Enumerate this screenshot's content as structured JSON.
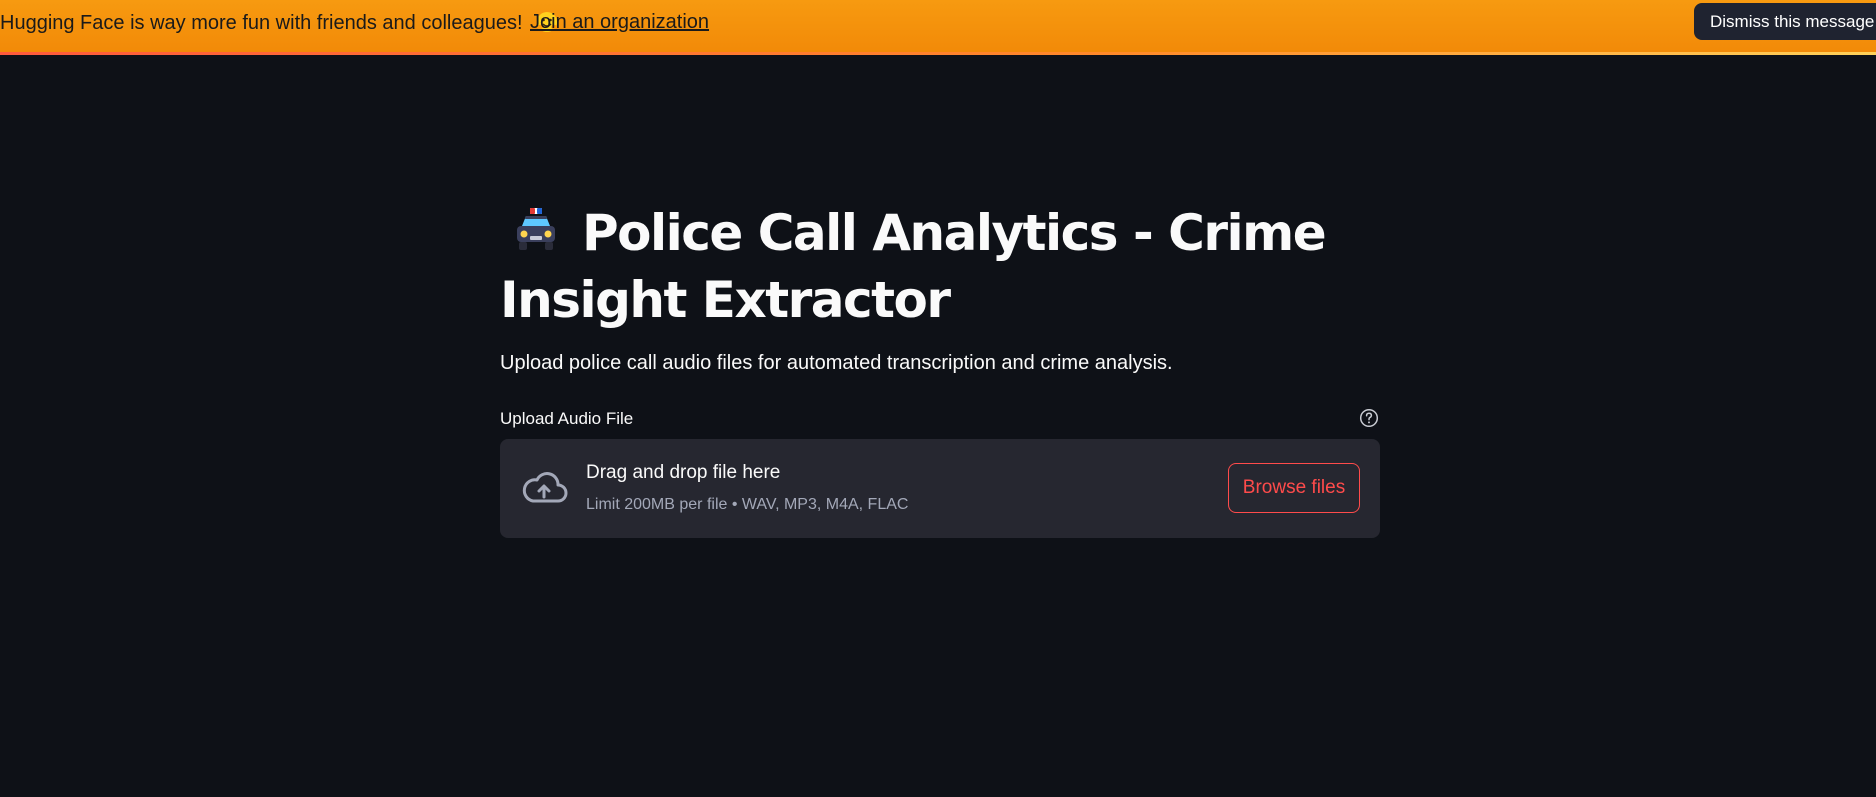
{
  "banner": {
    "message": "Hugging Face is way more fun with friends and colleagues!",
    "emoji_icon": "hugging-face-emoji-icon",
    "link_label": "Join an organization",
    "dismiss_label": "Dismiss this message",
    "gradient_colors": [
      "#f79a10",
      "#f28a08"
    ]
  },
  "app": {
    "title_icon": "police-car-icon",
    "title": "Police Call Analytics - Crime Insight Extractor",
    "subtitle": "Upload police call audio files for automated transcription and crime analysis.",
    "uploader": {
      "label": "Upload Audio File",
      "help_icon": "question-circle-icon",
      "upload_icon": "cloud-upload-icon",
      "drop_text": "Drag and drop file here",
      "limit_text": "Limit 200MB per file • WAV, MP3, M4A, FLAC",
      "browse_label": "Browse files"
    }
  },
  "colors": {
    "background": "#0e1117",
    "text": "#fafafa",
    "dropzone": "#262730",
    "accent": "#ff4b4b"
  }
}
